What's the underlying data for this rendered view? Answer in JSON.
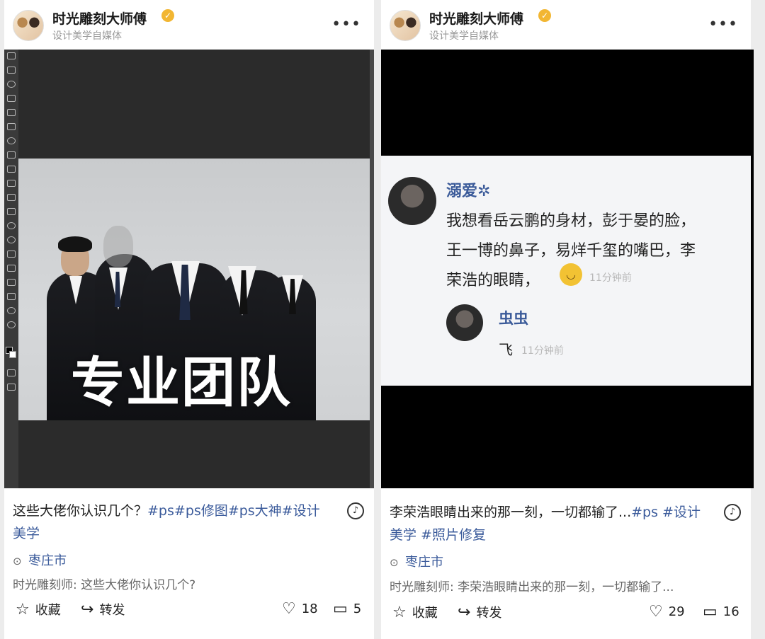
{
  "post1": {
    "user": {
      "name": "时光雕刻大师傅",
      "subtitle": "设计美学自媒体",
      "verified_icon": "verified-badge-icon"
    },
    "media": {
      "overlay_text": "专业团队",
      "toolbar_icons": [
        "move-icon",
        "marquee-icon",
        "lasso-icon",
        "magic-wand-icon",
        "crop-icon",
        "eyedropper-icon",
        "healing-icon",
        "brush-icon",
        "stamp-icon",
        "history-icon",
        "eraser-icon",
        "gradient-icon",
        "blur-icon",
        "dodge-icon",
        "pen-icon",
        "text-icon",
        "path-select-icon",
        "shape-icon",
        "hand-icon",
        "zoom-icon"
      ]
    },
    "caption_text": "这些大佬你认识几个？",
    "caption_tags": "#ps#ps修图#ps大神#设计美学",
    "location": "枣庄市",
    "summary": "时光雕刻师: 这些大佬你认识几个?",
    "actions": {
      "favorite": "收藏",
      "share": "转发",
      "likes": "18",
      "comments": "5"
    }
  },
  "post2": {
    "user": {
      "name": "时光雕刻大师傅",
      "subtitle": "设计美学自媒体",
      "verified_icon": "verified-badge-icon"
    },
    "comment": {
      "author": "溺爱✲",
      "line1": "我想看岳云鹏的身材，彭于晏的脸，",
      "line2": "王一博的鼻子，易烊千玺的嘴巴，李",
      "line3": "荣浩的眼睛，",
      "time": "11分钟前",
      "reply_author": "虫虫",
      "reply_text": "飞",
      "reply_time": "11分钟前"
    },
    "caption_text": "李荣浩眼睛出来的那一刻，一切都输了...",
    "caption_tags1": "#ps #设计",
    "caption_tags2": "美学 #照片修复",
    "location": "枣庄市",
    "summary": "时光雕刻师: 李荣浩眼睛出来的那一刻，一切都输了...",
    "actions": {
      "favorite": "收藏",
      "share": "转发",
      "likes": "29",
      "comments": "16"
    }
  },
  "colors": {
    "tag": "#3b5b9b",
    "verified": "#f2b632",
    "comment_name": "#3a5a99"
  }
}
